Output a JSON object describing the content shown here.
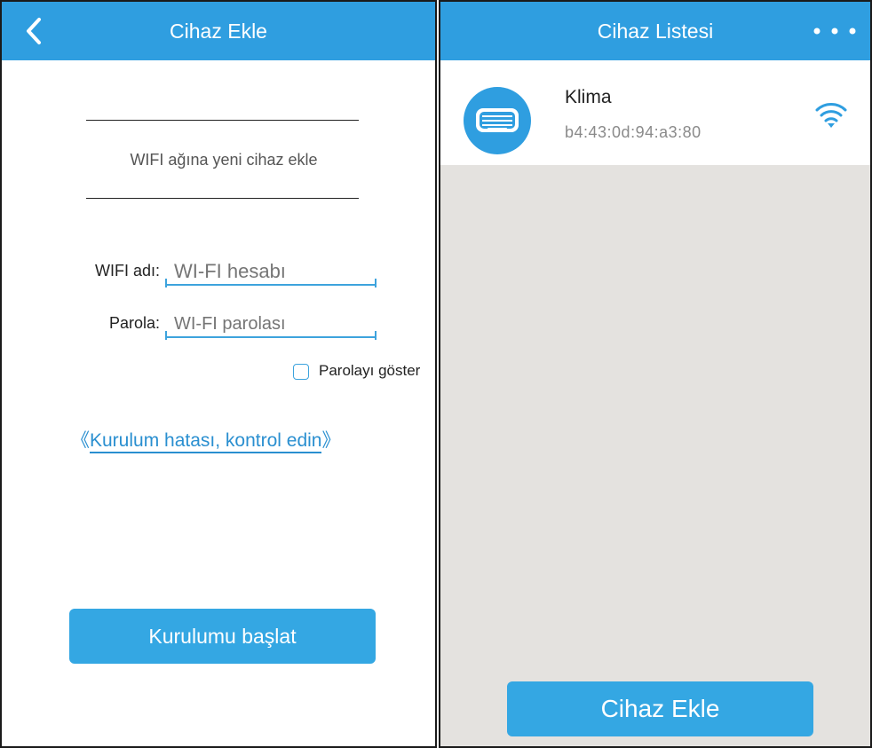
{
  "add_device_screen": {
    "title": "Cihaz Ekle",
    "subtitle": "WIFI ağına yeni cihaz ekle",
    "wifi_name_label": "WIFI adı:",
    "wifi_name_placeholder": "WI-FI hesabı",
    "password_label": "Parola:",
    "password_placeholder": "WI-FI parolası",
    "show_password_label": "Parolayı göster",
    "show_password_checked": false,
    "help_link_open": "《",
    "help_link_text": "Kurulum hatası, kontrol edin",
    "help_link_close": "》",
    "start_button_label": "Kurulumu başlat"
  },
  "device_list_screen": {
    "title": "Cihaz Listesi",
    "devices": [
      {
        "name": "Klima",
        "mac": "b4:43:0d:94:a3:80",
        "status_icon": "wifi-icon"
      }
    ],
    "add_button_label": "Cihaz Ekle"
  },
  "colors": {
    "accent": "#2f9ee0",
    "button": "#34a7e3",
    "link": "#2a8fd0",
    "list_background": "#e4e2df"
  }
}
